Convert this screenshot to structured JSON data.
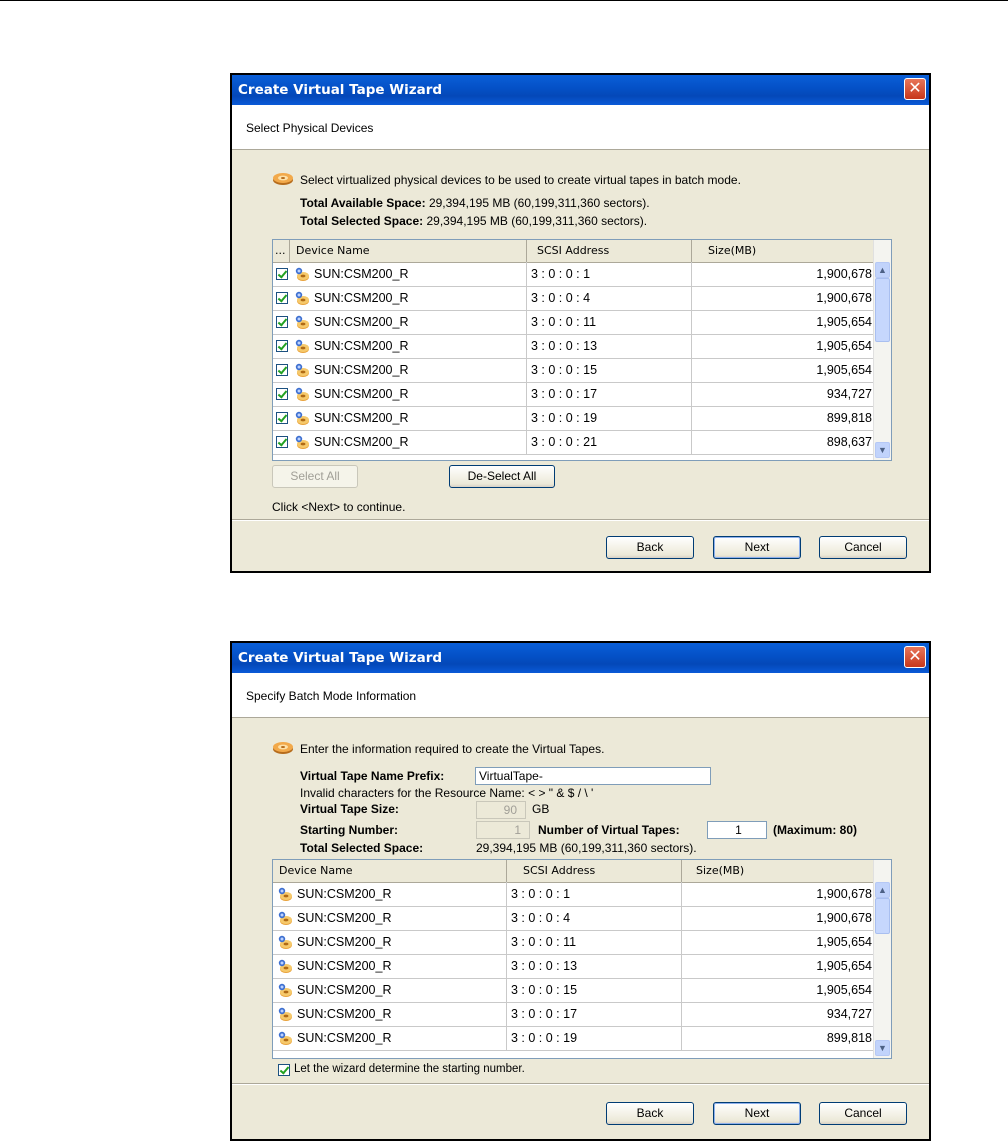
{
  "wizard1": {
    "title": "Create Virtual Tape Wizard",
    "close_glyph": "✕",
    "header": "Select Physical Devices",
    "description": "Select virtualized physical devices to be used to create virtual tapes in batch mode.",
    "available_label": "Total Available Space:",
    "available_value": "29,394,195 MB (60,199,311,360 sectors).",
    "selected_label": "Total Selected Space:",
    "selected_value": "29,394,195 MB (60,199,311,360 sectors).",
    "columns": {
      "check": "...",
      "device": "Device Name",
      "scsi": "SCSI Address",
      "size": "Size(MB)"
    },
    "rows": [
      {
        "device": "SUN:CSM200_R",
        "scsi": "3 : 0 : 0 : 1",
        "size": "1,900,678",
        "checked": true
      },
      {
        "device": "SUN:CSM200_R",
        "scsi": "3 : 0 : 0 : 4",
        "size": "1,900,678",
        "checked": true
      },
      {
        "device": "SUN:CSM200_R",
        "scsi": "3 : 0 : 0 : 11",
        "size": "1,905,654",
        "checked": true
      },
      {
        "device": "SUN:CSM200_R",
        "scsi": "3 : 0 : 0 : 13",
        "size": "1,905,654",
        "checked": true
      },
      {
        "device": "SUN:CSM200_R",
        "scsi": "3 : 0 : 0 : 15",
        "size": "1,905,654",
        "checked": true
      },
      {
        "device": "SUN:CSM200_R",
        "scsi": "3 : 0 : 0 : 17",
        "size": "934,727",
        "checked": true
      },
      {
        "device": "SUN:CSM200_R",
        "scsi": "3 : 0 : 0 : 19",
        "size": "899,818",
        "checked": true
      },
      {
        "device": "SUN:CSM200_R",
        "scsi": "3 : 0 : 0 : 21",
        "size": "898,637",
        "checked": true
      }
    ],
    "select_all": "Select All",
    "deselect_all": "De-Select All",
    "continue_hint": "Click <Next> to continue.",
    "back": "Back",
    "next": "Next",
    "cancel": "Cancel"
  },
  "wizard2": {
    "title": "Create Virtual Tape Wizard",
    "close_glyph": "✕",
    "header": "Specify Batch Mode Information",
    "description": "Enter the information required to create the Virtual Tapes.",
    "prefix_label": "Virtual Tape Name Prefix:",
    "prefix_value": "VirtualTape-",
    "invalid_chars": "Invalid characters for the Resource Name: < > \" & $ / \\ '",
    "size_label": "Virtual Tape Size:",
    "size_value": "90",
    "size_unit": "GB",
    "start_label": "Starting Number:",
    "start_value": "1",
    "num_label": "Number of Virtual Tapes:",
    "num_value": "1",
    "max_label": "(Maximum: 80)",
    "selected_label": "Total Selected Space:",
    "selected_value": "29,394,195 MB (60,199,311,360 sectors).",
    "columns": {
      "device": "Device Name",
      "scsi": "SCSI Address",
      "size": "Size(MB)"
    },
    "rows": [
      {
        "device": "SUN:CSM200_R",
        "scsi": "3 : 0 : 0 : 1",
        "size": "1,900,678"
      },
      {
        "device": "SUN:CSM200_R",
        "scsi": "3 : 0 : 0 : 4",
        "size": "1,900,678"
      },
      {
        "device": "SUN:CSM200_R",
        "scsi": "3 : 0 : 0 : 11",
        "size": "1,905,654"
      },
      {
        "device": "SUN:CSM200_R",
        "scsi": "3 : 0 : 0 : 13",
        "size": "1,905,654"
      },
      {
        "device": "SUN:CSM200_R",
        "scsi": "3 : 0 : 0 : 15",
        "size": "1,905,654"
      },
      {
        "device": "SUN:CSM200_R",
        "scsi": "3 : 0 : 0 : 17",
        "size": "934,727"
      },
      {
        "device": "SUN:CSM200_R",
        "scsi": "3 : 0 : 0 : 19",
        "size": "899,818"
      }
    ],
    "auto_start_label": "Let the wizard determine the starting number.",
    "auto_start_checked": true,
    "back": "Back",
    "next": "Next",
    "cancel": "Cancel"
  },
  "icons": {
    "wizard_icon": "tape-cartridge-icon",
    "device_icon": "tape-device-icon",
    "scroll_up": "▲",
    "scroll_down": "▼"
  }
}
